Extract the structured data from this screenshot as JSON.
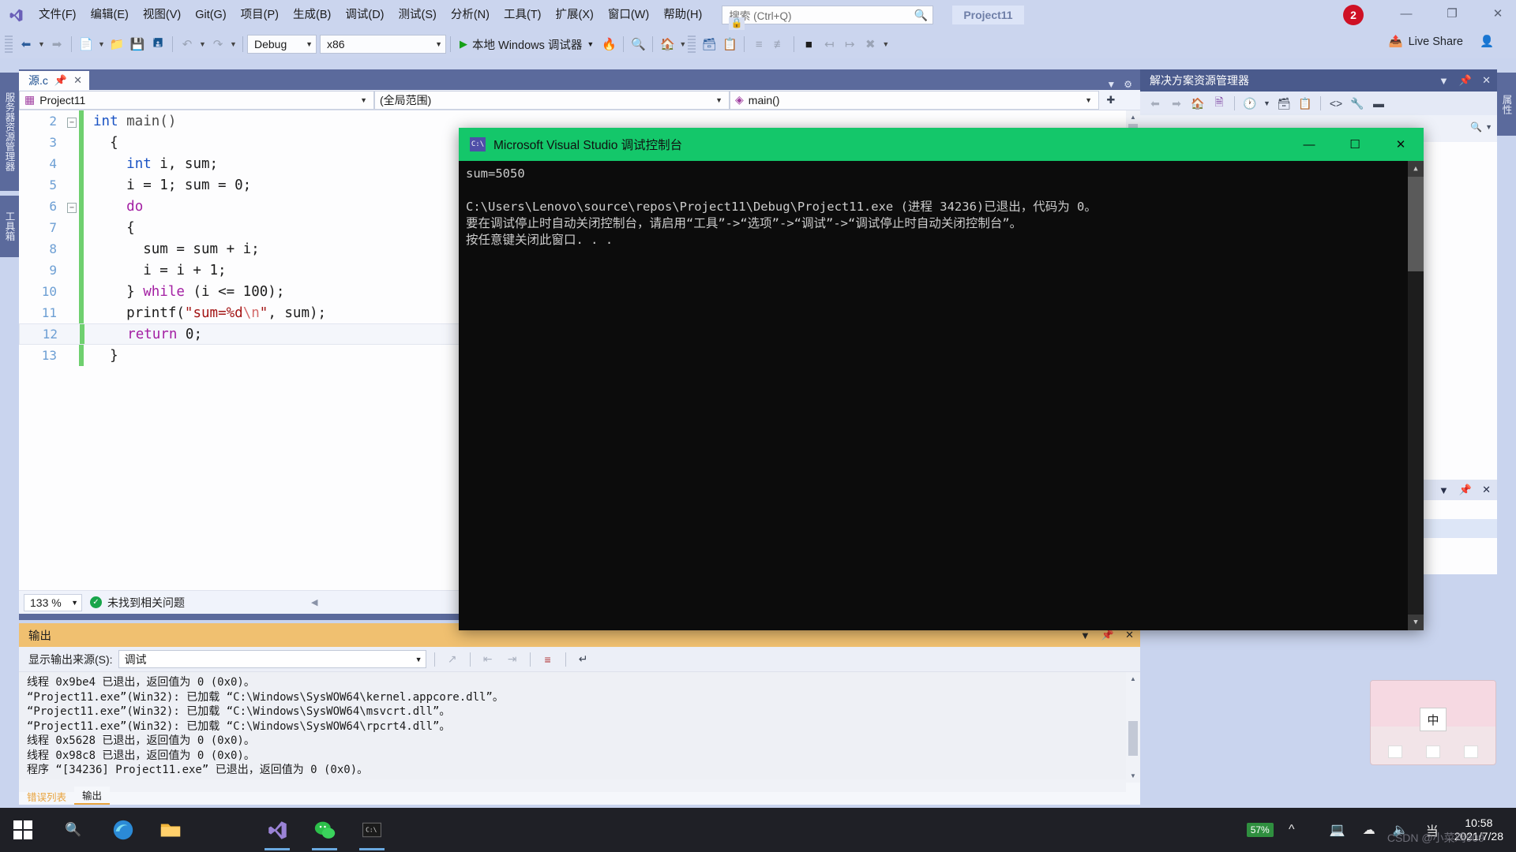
{
  "menubar": {
    "logo_icon": "visual-studio-logo",
    "items": [
      "文件(F)",
      "编辑(E)",
      "视图(V)",
      "Git(G)",
      "项目(P)",
      "生成(B)",
      "调试(D)",
      "测试(S)",
      "分析(N)",
      "工具(T)",
      "扩展(X)",
      "窗口(W)",
      "帮助(H)"
    ],
    "search_placeholder": "搜索 (Ctrl+Q)",
    "search_icon": "search-icon",
    "project_pill": "Project11",
    "notification_count": "2",
    "window_minimize": "—",
    "window_restore": "❐",
    "window_close": "✕"
  },
  "toolbar": {
    "nav_back_icon": "arrow-back-icon",
    "nav_forward_icon": "arrow-forward-icon",
    "new_item_icon": "new-file-icon",
    "open_icon": "open-folder-icon",
    "save_icon": "save-icon",
    "save_all_icon": "save-all-icon",
    "undo_icon": "undo-icon",
    "redo_icon": "redo-icon",
    "configuration": "Debug",
    "platform": "x86",
    "run_label": "本地 Windows 调试器",
    "run_icon": "play-triangle-icon",
    "hotreload_icon": "hot-reload-icon",
    "find_icon": "find-in-files-icon",
    "home_icon": "home-icon",
    "prop_icon": "properties-icon",
    "copy_icon": "copy-icon",
    "indent_icons": [
      "indent-icon",
      "outdent-icon"
    ],
    "bookmark_icon": "bookmark-icon",
    "bm_prev_icon": "bookmark-prev-icon",
    "bm_next_icon": "bookmark-next-icon",
    "bm_clear_icon": "bookmark-clear-icon",
    "overflow_icon": "toolbar-overflow-icon",
    "live_share_label": "Live Share",
    "live_share_icon": "live-share-icon",
    "live_share_user_icon": "share-user-icon"
  },
  "left_tabs": [
    "服务器资源管理器",
    "工具箱"
  ],
  "right_tabs": [
    "属性"
  ],
  "editor": {
    "tab_label": "源.c",
    "tab_pin_icon": "pin-icon",
    "tab_close_icon": "close-icon",
    "tab_chevron_icon": "chevron-down-icon",
    "tab_settings_icon": "gear-icon",
    "project_scope": "Project11",
    "project_icon": "project-icon",
    "global_scope": "(全局范围)",
    "function_scope": "main()",
    "function_icon": "method-icon",
    "split_icon": "split-view-icon",
    "zoom_level": "133 %",
    "status_text": "未找到相关问题",
    "status_icon": "check-circle-icon",
    "status_nav_icon": "prev-issue-icon",
    "lines": [
      {
        "n": "2",
        "glyph": "minus",
        "indent": 0,
        "tokens": [
          {
            "t": "int",
            "c": "k-blue"
          },
          {
            "t": " main()",
            "c": "k-fn"
          }
        ]
      },
      {
        "n": "3",
        "glyph": "",
        "indent": 1,
        "tokens": [
          {
            "t": "{",
            "c": ""
          }
        ]
      },
      {
        "n": "4",
        "glyph": "",
        "indent": 2,
        "tokens": [
          {
            "t": "int",
            "c": "k-blue"
          },
          {
            "t": " i, sum;",
            "c": ""
          }
        ]
      },
      {
        "n": "5",
        "glyph": "",
        "indent": 2,
        "tokens": [
          {
            "t": "i = 1; sum = 0;",
            "c": ""
          }
        ]
      },
      {
        "n": "6",
        "glyph": "minus",
        "indent": 2,
        "tokens": [
          {
            "t": "do",
            "c": "k-purple"
          }
        ]
      },
      {
        "n": "7",
        "glyph": "",
        "indent": 2,
        "tokens": [
          {
            "t": "{",
            "c": ""
          }
        ]
      },
      {
        "n": "8",
        "glyph": "",
        "indent": 3,
        "tokens": [
          {
            "t": "sum = sum + i;",
            "c": ""
          }
        ]
      },
      {
        "n": "9",
        "glyph": "",
        "indent": 3,
        "tokens": [
          {
            "t": "i = i + 1;",
            "c": ""
          }
        ]
      },
      {
        "n": "10",
        "glyph": "",
        "indent": 2,
        "tokens": [
          {
            "t": "} ",
            "c": ""
          },
          {
            "t": "while",
            "c": "k-purple"
          },
          {
            "t": " (i <= 100);",
            "c": ""
          }
        ]
      },
      {
        "n": "11",
        "glyph": "",
        "indent": 2,
        "tokens": [
          {
            "t": "printf(",
            "c": ""
          },
          {
            "t": "\"sum=%d",
            "c": "k-str"
          },
          {
            "t": "\\n",
            "c": "k-esc"
          },
          {
            "t": "\"",
            "c": "k-str"
          },
          {
            "t": ", sum);",
            "c": ""
          }
        ]
      },
      {
        "n": "12",
        "glyph": "",
        "indent": 2,
        "current": true,
        "tokens": [
          {
            "t": "return",
            "c": "k-purple"
          },
          {
            "t": " 0;",
            "c": ""
          }
        ]
      },
      {
        "n": "13",
        "glyph": "",
        "indent": 1,
        "tokens": [
          {
            "t": "}",
            "c": ""
          }
        ]
      }
    ]
  },
  "solution_explorer": {
    "title": "解决方案资源管理器",
    "chevron_icon": "chevron-down-icon",
    "pin_icon": "pin-icon",
    "close_icon": "close-icon",
    "tool_icons": [
      "back-icon",
      "forward-icon",
      "home-icon",
      "switch-views-icon",
      "pending-changes-icon",
      "show-all-files-icon",
      "refresh-icon",
      "collapse-all-icon",
      "view-code-icon",
      "properties-wrench-icon",
      "toolbar-dash-icon"
    ],
    "search_icon": "search-icon"
  },
  "properties_panel": {
    "chevron_icon": "chevron-down-icon",
    "pin_icon": "pin-icon",
    "close_icon": "close-icon"
  },
  "output_panel": {
    "title": "输出",
    "chevron_icon": "chevron-down-icon",
    "pin_icon": "pin-icon",
    "close_icon": "close-icon",
    "source_label": "显示输出来源(S):",
    "source_value": "调试",
    "tool_icons": [
      "jump-to-icon",
      "go-up-icon",
      "go-down-icon",
      "clear-all-icon",
      "toggle-wordwrap-icon"
    ],
    "log_lines": [
      "线程 0x9be4 已退出，返回值为 0 (0x0)。",
      "“Project11.exe”(Win32): 已加载 “C:\\Windows\\SysWOW64\\kernel.appcore.dll”。",
      "“Project11.exe”(Win32): 已加载 “C:\\Windows\\SysWOW64\\msvcrt.dll”。",
      "“Project11.exe”(Win32): 已加载 “C:\\Windows\\SysWOW64\\rpcrt4.dll”。",
      "线程 0x5628 已退出，返回值为 0 (0x0)。",
      "线程 0x98c8 已退出，返回值为 0 (0x0)。",
      "程序 “[34236] Project11.exe” 已退出，返回值为 0 (0x0)。"
    ],
    "bottom_tabs": [
      {
        "label": "错误列表",
        "selected": false
      },
      {
        "label": "输出",
        "selected": true
      }
    ]
  },
  "console_window": {
    "title": "Microsoft Visual Studio 调试控制台",
    "icon": "console-icon",
    "minimize": "—",
    "maximize": "☐",
    "close": "✕",
    "lines": [
      "sum=5050",
      "",
      "C:\\Users\\Lenovo\\source\\repos\\Project11\\Debug\\Project11.exe (进程 34236)已退出，代码为 0。",
      "要在调试停止时自动关闭控制台，请启用“工具”->“选项”->“调试”->“调试停止时自动关闭控制台”。",
      "按任意键关闭此窗口. . ."
    ],
    "titlebar_color": "#14c76a",
    "background_color": "#0c0c0c"
  },
  "taskbar": {
    "start_icon": "windows-start-icon",
    "search_icon": "taskbar-search-icon",
    "apps": [
      {
        "name": "edge-icon",
        "active": false
      },
      {
        "name": "file-explorer-icon",
        "active": false
      },
      {
        "name": "visual-studio-icon",
        "active": true
      },
      {
        "name": "wechat-icon",
        "active": true
      },
      {
        "name": "console-window-icon",
        "active": true
      }
    ],
    "tray_icons": [
      "battery-saver-icon",
      "show-hidden-icons-icon",
      "monitor-icon",
      "network-icon",
      "volume-icon",
      "ime-icon"
    ],
    "battery_percent": "57%",
    "clock_time": "10:58",
    "clock_date": "2021/7/28",
    "watermark": "CSDN @小菜鸡909"
  },
  "ime_widget": {
    "char": "中"
  },
  "colors": {
    "accent_blue": "#cbd5ee",
    "panel_border": "#5b6a9c",
    "console_green": "#14c76a",
    "output_header": "#f0c070",
    "notification_red": "#cf1125",
    "change_bar_green": "#6fd06f"
  }
}
